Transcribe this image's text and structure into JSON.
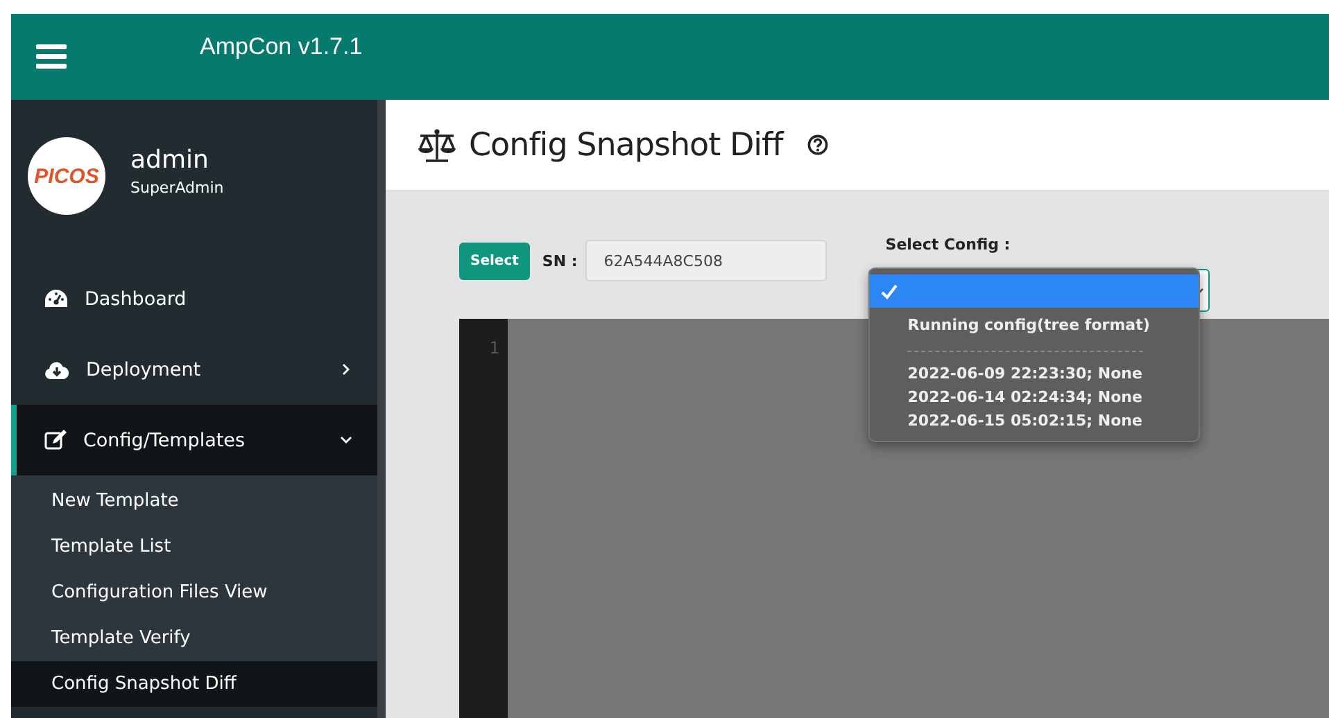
{
  "topbar": {
    "title": "AmpCon v1.7.1"
  },
  "profile": {
    "logo": "PICOS",
    "name": "admin",
    "role": "SuperAdmin"
  },
  "sidebar": {
    "items": [
      {
        "label": "Dashboard",
        "expandable": false,
        "selected": false
      },
      {
        "label": "Deployment",
        "expandable": true,
        "expanded": false,
        "selected": false
      },
      {
        "label": "Config/Templates",
        "expandable": true,
        "expanded": true,
        "selected": true,
        "children": [
          {
            "label": "New Template",
            "selected": false
          },
          {
            "label": "Template List",
            "selected": false
          },
          {
            "label": "Configuration Files View",
            "selected": false
          },
          {
            "label": "Template Verify",
            "selected": false
          },
          {
            "label": "Config Snapshot Diff",
            "selected": true
          }
        ]
      }
    ]
  },
  "page": {
    "title": "Config Snapshot Diff"
  },
  "form": {
    "select_button": "Select",
    "sn_label": "SN :",
    "sn_value": "62A544A8C508",
    "config_label": "Select Config :"
  },
  "dropdown": {
    "options": [
      {
        "kind": "blank",
        "selected": true
      },
      {
        "kind": "option",
        "label": "Running config(tree format)",
        "selected": false
      },
      {
        "kind": "separator"
      },
      {
        "kind": "option",
        "label": "2022-06-09 22:23:30; None",
        "selected": false
      },
      {
        "kind": "option",
        "label": "2022-06-14 02:24:34; None",
        "selected": false
      },
      {
        "kind": "option",
        "label": "2022-06-15 05:02:15; None",
        "selected": false
      }
    ]
  },
  "editor": {
    "line_numbers": [
      "1"
    ]
  }
}
